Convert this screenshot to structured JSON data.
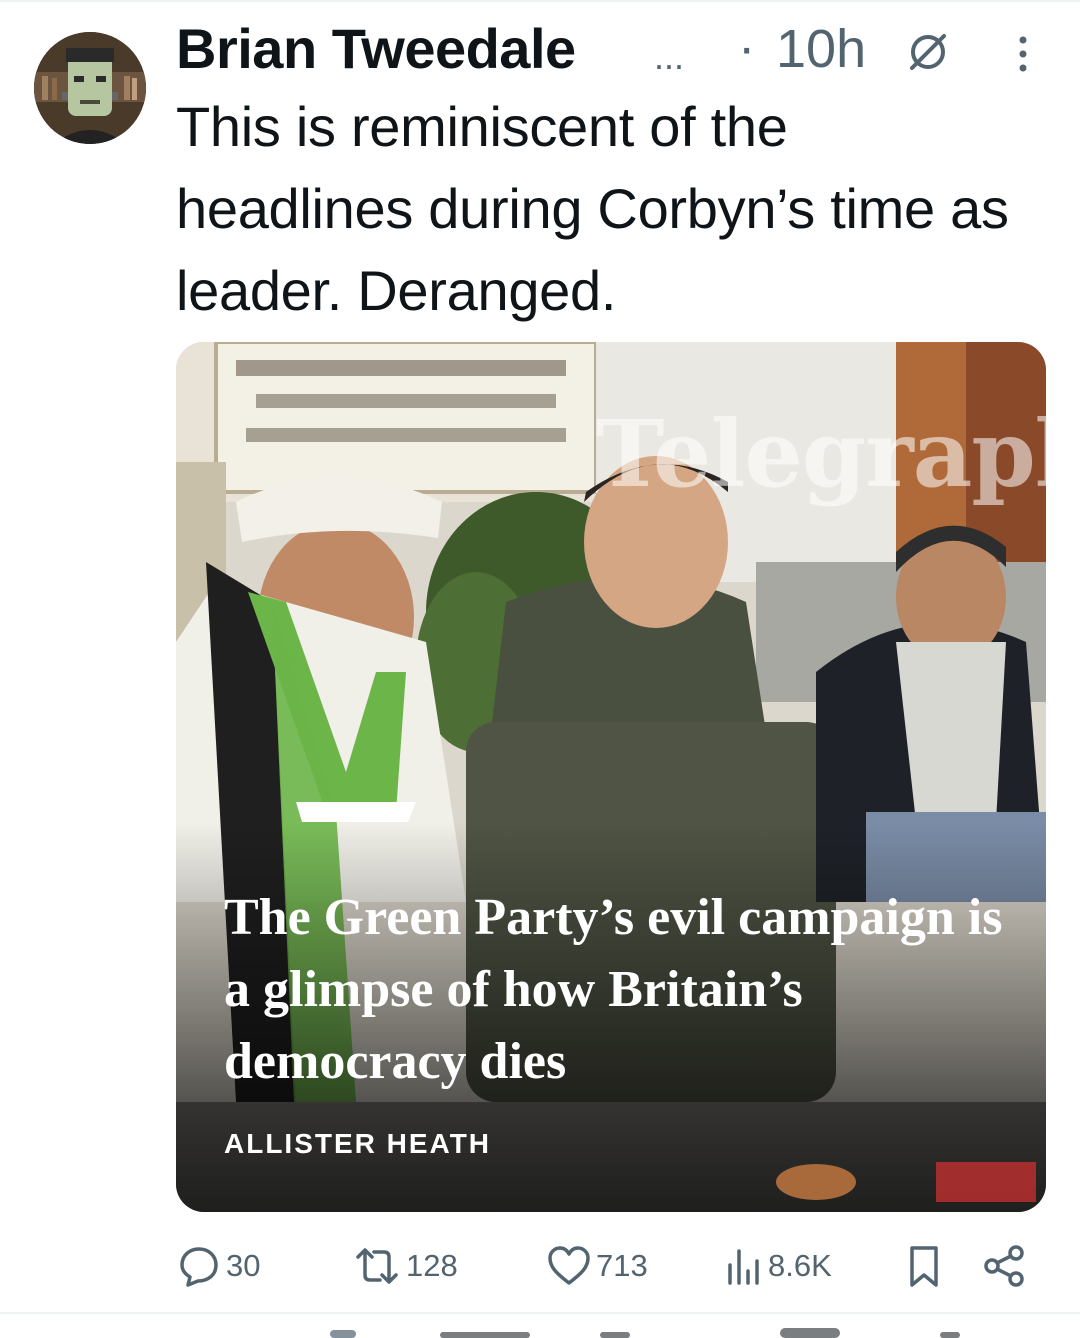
{
  "tweet": {
    "author_name": "Brian Tweedale",
    "name_truncation": "...",
    "dot": "·",
    "time": "10h",
    "text": "This is reminiscent of the headlines during Corbyn’s time as leader. Deranged."
  },
  "media": {
    "watermark": "Telegraph",
    "headline": "The Green Party’s evil campaign is a glimpse of how Britain’s democracy dies",
    "byline": "ALLISTER HEATH"
  },
  "actions": {
    "replies": "30",
    "reposts": "128",
    "likes": "713",
    "views": "8.6K"
  },
  "icons": [
    "avatar",
    "no-link-icon",
    "more-options-icon",
    "reply-icon",
    "repost-icon",
    "like-icon",
    "views-icon",
    "bookmark-icon",
    "share-icon"
  ],
  "colors": {
    "text": "#0f1419",
    "secondary": "#536471",
    "divider": "#eff3f4"
  }
}
